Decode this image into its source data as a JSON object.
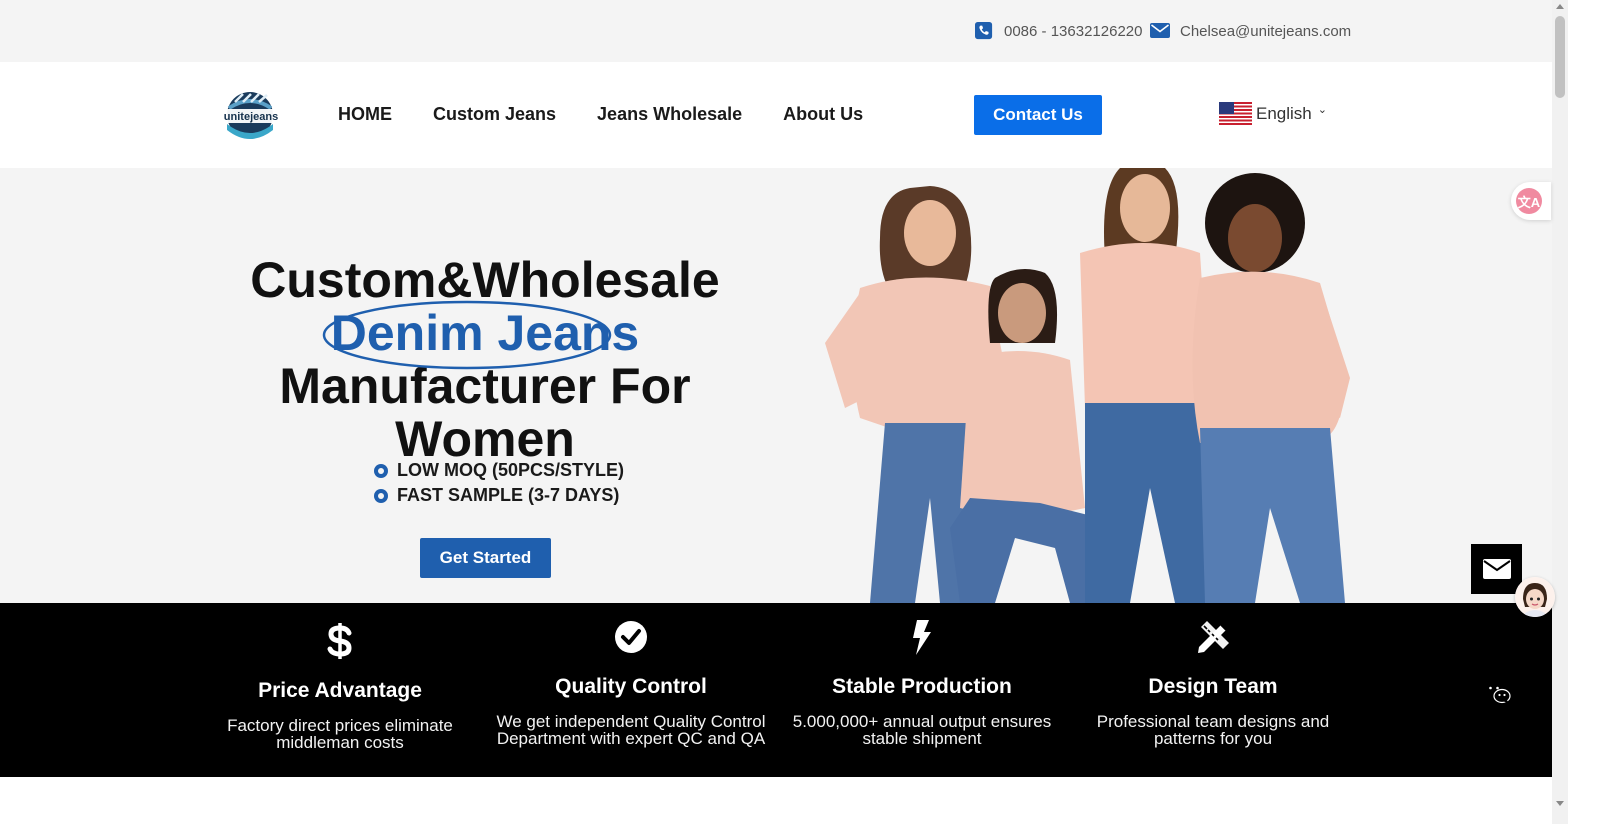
{
  "topbar": {
    "phone": "0086 - 13632126220",
    "email": "Chelsea@unitejeans.com",
    "phone_icon": "phone-icon",
    "email_icon": "envelope-icon"
  },
  "header": {
    "logo_text": "unitejeans",
    "nav": [
      {
        "label": "HOME"
      },
      {
        "label": "Custom Jeans"
      },
      {
        "label": "Jeans Wholesale"
      },
      {
        "label": "About Us"
      }
    ],
    "contact_button": "Contact Us",
    "language": "English"
  },
  "hero": {
    "title_line1": "Custom&Wholesale",
    "title_line2": "Denim Jeans",
    "title_line3": "Manufacturer For Women",
    "bullets": [
      "LOW MOQ (50PCS/STYLE)",
      "FAST SAMPLE (3-7 DAYS)"
    ],
    "cta": "Get Started"
  },
  "features": [
    {
      "icon": "dollar-icon",
      "title": "Price Advantage",
      "desc_line1": "Factory direct prices eliminate",
      "desc_line2": "middleman costs"
    },
    {
      "icon": "check-circle-icon",
      "title": "Quality Control",
      "desc_line1": "We get independent Quality Control",
      "desc_line2": "Department with expert QC and QA"
    },
    {
      "icon": "bolt-icon",
      "title": "Stable Production",
      "desc_line1": "5.000,000+ annual output ensures",
      "desc_line2": "stable shipment"
    },
    {
      "icon": "design-tools-icon",
      "title": "Design Team",
      "desc_line1": "Professional team designs and",
      "desc_line2": "patterns for you"
    }
  ],
  "colors": {
    "accent_blue": "#1f5fae",
    "contact_blue": "#0a6ee8",
    "band_black": "#000000",
    "topbar_grey": "#f4f4f4"
  },
  "floating": {
    "translate_label": "文A",
    "mail_icon": "envelope-icon",
    "whatsapp_icon": "whatsapp-icon",
    "wechat_icon": "wechat-icon"
  }
}
